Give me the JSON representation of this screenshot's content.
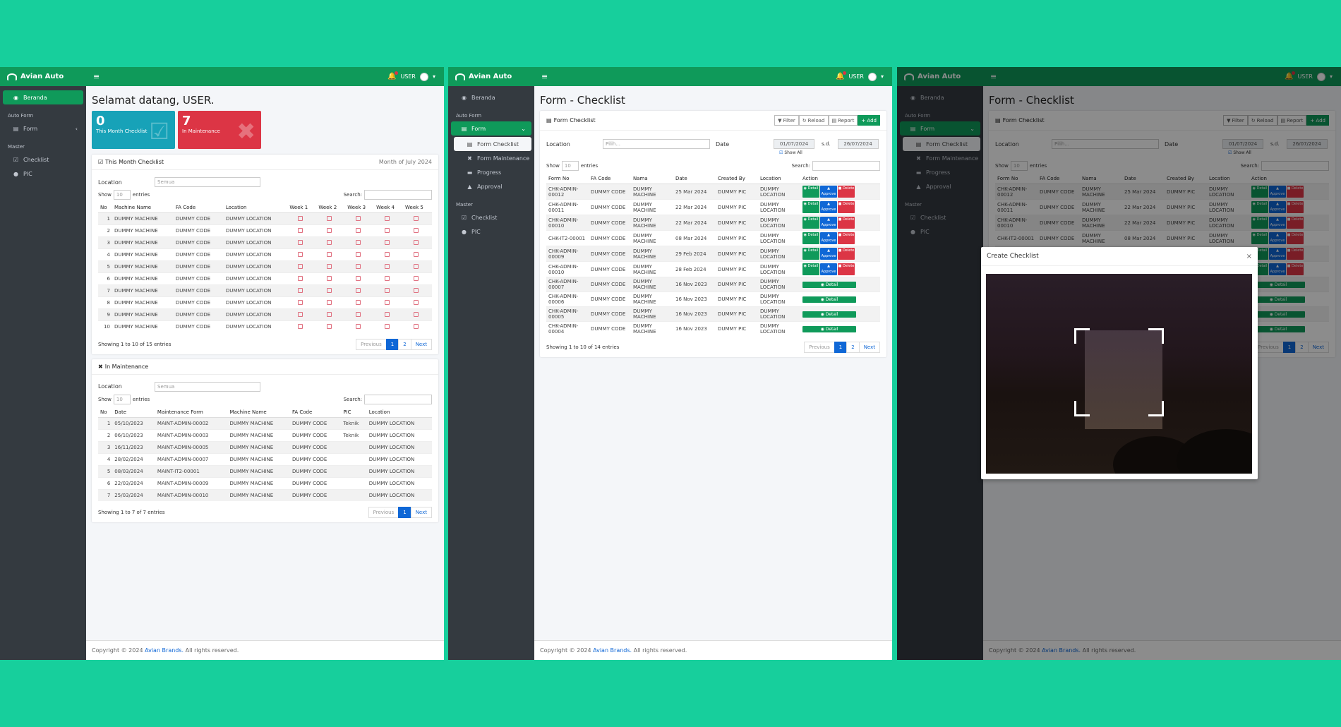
{
  "brand": "Avian Auto",
  "user": "USER",
  "sidebar": {
    "beranda": "Beranda",
    "auto_form": "Auto Form",
    "form": "Form",
    "form_checklist": "Form Checklist",
    "form_maintenance": "Form Maintenance",
    "progress": "Progress",
    "approval": "Approval",
    "master": "Master",
    "checklist": "Checklist",
    "pic": "PIC"
  },
  "footer": {
    "pre": "Copyright © 2024 ",
    "link": "Avian Brands.",
    "post": " All rights reserved."
  },
  "dashboard": {
    "welcome": "Selamat datang, USER.",
    "box1": {
      "num": "0",
      "label": "This Month Checklist",
      "color": "#17a2b8"
    },
    "box2": {
      "num": "7",
      "label": "In Maintenance",
      "color": "#dc3545"
    },
    "checklist_card": {
      "title": "This Month Checklist",
      "month": "Month of July 2024",
      "location_label": "Location",
      "location_value": "Semua",
      "show": "Show",
      "entries": "entries",
      "entries_value": "10",
      "search": "Search:",
      "columns": [
        "No",
        "Machine Name",
        "FA Code",
        "Location",
        "Week 1",
        "Week 2",
        "Week 3",
        "Week 4",
        "Week 5"
      ],
      "rows": [
        [
          "1",
          "DUMMY MACHINE",
          "DUMMY CODE",
          "DUMMY LOCATION"
        ],
        [
          "2",
          "DUMMY MACHINE",
          "DUMMY CODE",
          "DUMMY LOCATION"
        ],
        [
          "3",
          "DUMMY MACHINE",
          "DUMMY CODE",
          "DUMMY LOCATION"
        ],
        [
          "4",
          "DUMMY MACHINE",
          "DUMMY CODE",
          "DUMMY LOCATION"
        ],
        [
          "5",
          "DUMMY MACHINE",
          "DUMMY CODE",
          "DUMMY LOCATION"
        ],
        [
          "6",
          "DUMMY MACHINE",
          "DUMMY CODE",
          "DUMMY LOCATION"
        ],
        [
          "7",
          "DUMMY MACHINE",
          "DUMMY CODE",
          "DUMMY LOCATION"
        ],
        [
          "8",
          "DUMMY MACHINE",
          "DUMMY CODE",
          "DUMMY LOCATION"
        ],
        [
          "9",
          "DUMMY MACHINE",
          "DUMMY CODE",
          "DUMMY LOCATION"
        ],
        [
          "10",
          "DUMMY MACHINE",
          "DUMMY CODE",
          "DUMMY LOCATION"
        ]
      ],
      "info": "Showing 1 to 10 of 15 entries",
      "pages": [
        "Previous",
        "1",
        "2",
        "Next"
      ]
    },
    "maint_card": {
      "title": "In Maintenance",
      "location_label": "Location",
      "location_value": "Semua",
      "show": "Show",
      "entries": "entries",
      "entries_value": "10",
      "search": "Search:",
      "columns": [
        "No",
        "Date",
        "Maintenance Form",
        "Machine Name",
        "FA Code",
        "PIC",
        "Location"
      ],
      "rows": [
        [
          "1",
          "05/10/2023",
          "MAINT-ADMIN-00002",
          "DUMMY MACHINE",
          "DUMMY CODE",
          "Teknik",
          "DUMMY LOCATION"
        ],
        [
          "2",
          "06/10/2023",
          "MAINT-ADMIN-00003",
          "DUMMY MACHINE",
          "DUMMY CODE",
          "Teknik",
          "DUMMY LOCATION"
        ],
        [
          "3",
          "16/11/2023",
          "MAINT-ADMIN-00005",
          "DUMMY MACHINE",
          "DUMMY CODE",
          "",
          "DUMMY LOCATION"
        ],
        [
          "4",
          "28/02/2024",
          "MAINT-ADMIN-00007",
          "DUMMY MACHINE",
          "DUMMY CODE",
          "",
          "DUMMY LOCATION"
        ],
        [
          "5",
          "08/03/2024",
          "MAINT-IT2-00001",
          "DUMMY MACHINE",
          "DUMMY CODE",
          "",
          "DUMMY LOCATION"
        ],
        [
          "6",
          "22/03/2024",
          "MAINT-ADMIN-00009",
          "DUMMY MACHINE",
          "DUMMY CODE",
          "",
          "DUMMY LOCATION"
        ],
        [
          "7",
          "25/03/2024",
          "MAINT-ADMIN-00010",
          "DUMMY MACHINE",
          "DUMMY CODE",
          "",
          "DUMMY LOCATION"
        ]
      ],
      "info": "Showing 1 to 7 of 7 entries",
      "pages": [
        "Previous",
        "1",
        "Next"
      ]
    }
  },
  "checklist_page": {
    "title": "Form - Checklist",
    "card_title": "Form Checklist",
    "buttons": {
      "filter": "Filter",
      "reload": "Reload",
      "report": "Report",
      "add": "+ Add"
    },
    "location_label": "Location",
    "location_placeholder": "Pilih...",
    "date_label": "Date",
    "date_from": "01/07/2024",
    "sd": "s.d.",
    "date_to": "26/07/2024",
    "show_all": "Show All",
    "show": "Show",
    "entries": "entries",
    "entries_value": "10",
    "search": "Search:",
    "columns": [
      "Form No",
      "FA Code",
      "Nama",
      "Date",
      "Created By",
      "Location",
      "Action"
    ],
    "rows": [
      {
        "form": "CHK-ADMIN-00012",
        "fa": "DUMMY CODE",
        "nama": "DUMMY MACHINE",
        "date": "25 Mar 2024",
        "by": "DUMMY PIC",
        "loc": "DUMMY LOCATION",
        "full": true
      },
      {
        "form": "CHK-ADMIN-00011",
        "fa": "DUMMY CODE",
        "nama": "DUMMY MACHINE",
        "date": "22 Mar 2024",
        "by": "DUMMY PIC",
        "loc": "DUMMY LOCATION",
        "full": true
      },
      {
        "form": "CHK-ADMIN-00010",
        "fa": "DUMMY CODE",
        "nama": "DUMMY MACHINE",
        "date": "22 Mar 2024",
        "by": "DUMMY PIC",
        "loc": "DUMMY LOCATION",
        "full": true
      },
      {
        "form": "CHK-IT2-00001",
        "fa": "DUMMY CODE",
        "nama": "DUMMY MACHINE",
        "date": "08 Mar 2024",
        "by": "DUMMY PIC",
        "loc": "DUMMY LOCATION",
        "full": true
      },
      {
        "form": "CHK-ADMIN-00009",
        "fa": "DUMMY CODE",
        "nama": "DUMMY MACHINE",
        "date": "29 Feb 2024",
        "by": "DUMMY PIC",
        "loc": "DUMMY LOCATION",
        "full": true
      },
      {
        "form": "CHK-ADMIN-00010",
        "fa": "DUMMY CODE",
        "nama": "DUMMY MACHINE",
        "date": "28 Feb 2024",
        "by": "DUMMY PIC",
        "loc": "DUMMY LOCATION",
        "full": true
      },
      {
        "form": "CHK-ADMIN-00007",
        "fa": "DUMMY CODE",
        "nama": "DUMMY MACHINE",
        "date": "16 Nov 2023",
        "by": "DUMMY PIC",
        "loc": "DUMMY LOCATION",
        "full": false
      },
      {
        "form": "CHK-ADMIN-00006",
        "fa": "DUMMY CODE",
        "nama": "DUMMY MACHINE",
        "date": "16 Nov 2023",
        "by": "DUMMY PIC",
        "loc": "DUMMY LOCATION",
        "full": false
      },
      {
        "form": "CHK-ADMIN-00005",
        "fa": "DUMMY CODE",
        "nama": "DUMMY MACHINE",
        "date": "16 Nov 2023",
        "by": "DUMMY PIC",
        "loc": "DUMMY LOCATION",
        "full": false
      },
      {
        "form": "CHK-ADMIN-00004",
        "fa": "DUMMY CODE",
        "nama": "DUMMY MACHINE",
        "date": "16 Nov 2023",
        "by": "DUMMY PIC",
        "loc": "DUMMY LOCATION",
        "full": false
      }
    ],
    "actions": {
      "detail": "Detail",
      "approve": "Approve",
      "delete": "Delete"
    },
    "info": "Showing 1 to 10 of 14 entries",
    "pages": [
      "Previous",
      "1",
      "2",
      "Next"
    ]
  },
  "third": {
    "created_by": "Created By",
    "modal_title": "Create Checklist",
    "close": "×"
  }
}
